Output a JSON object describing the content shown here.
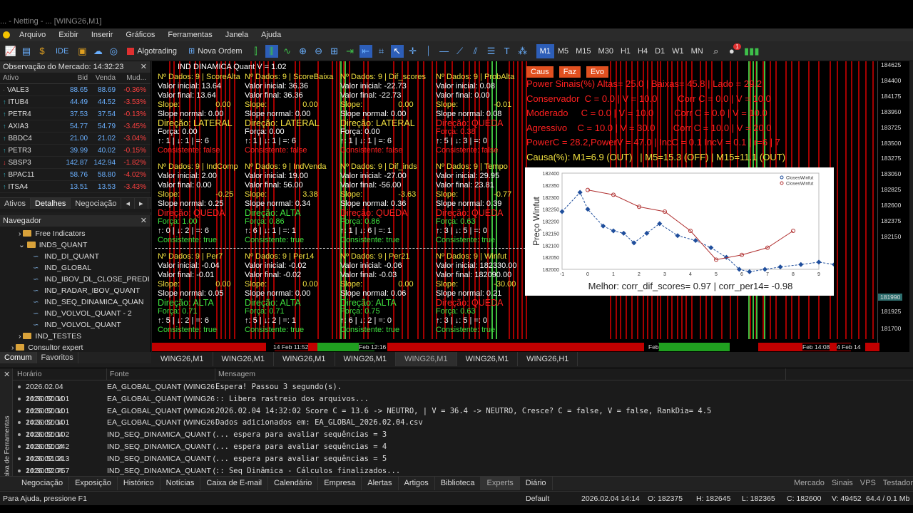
{
  "window": {
    "title_partial": "... - Netting - ... [WING26,M1]"
  },
  "menu": [
    "Arquivo",
    "Exibir",
    "Inserir",
    "Gráficos",
    "Ferramentas",
    "Janela",
    "Ajuda"
  ],
  "toolbar": {
    "algotrading": "Algotrading",
    "new_order": "Nova Ordem",
    "ide": "IDE",
    "timeframes": [
      "M1",
      "M5",
      "M15",
      "M30",
      "H1",
      "H4",
      "D1",
      "W1",
      "MN"
    ],
    "active_tf": "M1",
    "notif_count": "1"
  },
  "market_watch": {
    "title": "Observação do Mercado: 14:32:23",
    "cols": [
      "Ativo",
      "Bid",
      "Venda",
      "Mud..."
    ],
    "rows": [
      {
        "sym": "VALE3",
        "bid": "88.65",
        "ask": "88.69",
        "chg": "-0.36%",
        "dir": "none"
      },
      {
        "sym": "ITUB4",
        "bid": "44.49",
        "ask": "44.52",
        "chg": "-3.53%",
        "dir": "up"
      },
      {
        "sym": "PETR4",
        "bid": "37.53",
        "ask": "37.54",
        "chg": "-0.13%",
        "dir": "up"
      },
      {
        "sym": "AXIA3",
        "bid": "54.77",
        "ask": "54.79",
        "chg": "-3.45%",
        "dir": "up"
      },
      {
        "sym": "BBDC4",
        "bid": "21.00",
        "ask": "21.02",
        "chg": "-3.04%",
        "dir": "up"
      },
      {
        "sym": "PETR3",
        "bid": "39.99",
        "ask": "40.02",
        "chg": "-0.15%",
        "dir": "up"
      },
      {
        "sym": "SBSP3",
        "bid": "142.87",
        "ask": "142.94",
        "chg": "-1.82%",
        "dir": "down"
      },
      {
        "sym": "BPAC11",
        "bid": "58.76",
        "ask": "58.80",
        "chg": "-4.02%",
        "dir": "up"
      },
      {
        "sym": "ITSA4",
        "bid": "13.51",
        "ask": "13.53",
        "chg": "-3.43%",
        "dir": "up"
      }
    ],
    "tabs": [
      "Ativos",
      "Detalhes",
      "Negociação"
    ]
  },
  "navigator": {
    "title": "Navegador",
    "items": [
      {
        "label": "Free Indicators",
        "type": "folder",
        "indent": 2
      },
      {
        "label": "INDS_QUANT",
        "type": "folder",
        "indent": 2
      },
      {
        "label": "IND_DI_QUANT",
        "type": "ind",
        "indent": 4
      },
      {
        "label": "IND_GLOBAL",
        "type": "ind",
        "indent": 4
      },
      {
        "label": "IND_IBOV_DL_CLOSE_PREDI",
        "type": "ind",
        "indent": 4
      },
      {
        "label": "IND_RADAR_IBOV_QUANT",
        "type": "ind",
        "indent": 4
      },
      {
        "label": "IND_SEQ_DINAMICA_QUAN",
        "type": "ind",
        "indent": 4
      },
      {
        "label": "IND_VOLVOL_QUANT - 2",
        "type": "ind",
        "indent": 4
      },
      {
        "label": "IND_VOLVOL_QUANT",
        "type": "ind",
        "indent": 4
      },
      {
        "label": "IND_TESTES",
        "type": "folder",
        "indent": 2
      },
      {
        "label": "Consultor expert",
        "type": "folder",
        "indent": 1
      }
    ],
    "tabs": [
      "Comum",
      "Favoritos"
    ]
  },
  "chart": {
    "indicator_label": "IND DINAMICA Quant V = 1.02",
    "panels": [
      {
        "title": "Nº Dados: 9 | ScoreAlta",
        "vi": "Valor inicial: 13.64",
        "vf": "Valor final: 13.64",
        "slope": "Slope:",
        "slopev": "0.00",
        "sn": "Slope normal: 0.00",
        "dir": "Direção: LATERAL",
        "dircol": "y",
        "forca": "Força:  0.00",
        "fcol": "w",
        "seq": "↑: 1 | ↓: 1 | =: 6",
        "cons": "Consistente: false",
        "ccol": "r"
      },
      {
        "title": "Nº Dados: 9 | ScoreBaixa",
        "vi": "Valor inicial: 36.36",
        "vf": "Valor final: 36.36",
        "slope": "Slope:",
        "slopev": "0.00",
        "sn": "Slope normal: 0.00",
        "dir": "Direção: LATERAL",
        "dircol": "y",
        "forca": "Força:  0.00",
        "fcol": "w",
        "seq": "↑: 1 | ↓: 1 | =: 6",
        "cons": "Consistente: false",
        "ccol": "r"
      },
      {
        "title": "Nº Dados: 9 | Dif_scores",
        "vi": "Valor inicial: -22.73",
        "vf": "Valor final:  -22.73",
        "slope": "Slope:",
        "slopev": "0.00",
        "sn": "Slope normal: 0.00",
        "dir": "Direção: LATERAL",
        "dircol": "y",
        "forca": "Força:  0.00",
        "fcol": "w",
        "seq": "↑: 1 | ↓: 1 | =: 6",
        "cons": "Consistente: false",
        "ccol": "r"
      },
      {
        "title": "Nº Dados: 9 | ProbAlta",
        "vi": "Valor inicial: 0.08",
        "vf": "Valor final:  0.00",
        "slope": "Slope:",
        "slopev": "-0.01",
        "sn": "Slope normal: 0.08",
        "dir": "Direção: QUEDA",
        "dircol": "r",
        "forca": "Força:  0.38",
        "fcol": "r",
        "seq": "↑: 5 | ↓: 3 | =: 0",
        "cons": "Consistente: false",
        "ccol": "r"
      },
      {
        "title": "Nº Dados: 9 | IndComp",
        "vi": "Valor inicial: 2.00",
        "vf": "Valor final:  0.00",
        "slope": "Slope:",
        "slopev": "-0.25",
        "sn": "Slope normal: 0.25",
        "dir": "Direção: QUEDA",
        "dircol": "r",
        "forca": "Força:  1.00",
        "fcol": "g",
        "seq": "↑: 0 | ↓: 2 | =: 6",
        "cons": "Consistente: true",
        "ccol": "g"
      },
      {
        "title": "Nº Dados: 9 | IndVenda",
        "vi": "Valor inicial: 19.00",
        "vf": "Valor final:  56.00",
        "slope": "Slope:",
        "slopev": "3.38",
        "sn": "Slope normal: 0.34",
        "dir": "Direção: ALTA",
        "dircol": "g",
        "forca": "Força:  0.86",
        "fcol": "g",
        "seq": "↑: 6 | ↓: 1 | =: 1",
        "cons": "Consistente: true",
        "ccol": "g"
      },
      {
        "title": "Nº Dados: 9 | Dif_inds",
        "vi": "Valor inicial: -27.00",
        "vf": "Valor final:  -56.00",
        "slope": "Slope:",
        "slopev": "-3.63",
        "sn": "Slope normal: 0.36",
        "dir": "Direção: QUEDA",
        "dircol": "r",
        "forca": "Força:  0.86",
        "fcol": "g",
        "seq": "↑: 1 | ↓: 6 | =: 1",
        "cons": "Consistente: true",
        "ccol": "g"
      },
      {
        "title": "Nº Dados: 9 | Tempo",
        "vi": "Valor inicial: 29.95",
        "vf": "Valor final:  23.81",
        "slope": "Slope:",
        "slopev": "-0.77",
        "sn": "Slope normal: 0.39",
        "dir": "Direção: QUEDA",
        "dircol": "r",
        "forca": "Força:  0.63",
        "fcol": "g",
        "seq": "↑: 3 | ↓: 5 | =: 0",
        "cons": "Consistente: true",
        "ccol": "g"
      },
      {
        "title": "Nº Dados: 9 | Per7",
        "vi": "Valor inicial: -0.04",
        "vf": "Valor final:  -0.01",
        "slope": "Slope:",
        "slopev": "0.00",
        "sn": "Slope normal: 0.05",
        "dir": "Direção: ALTA",
        "dircol": "g",
        "forca": "Força:  0.71",
        "fcol": "g",
        "seq": "↑: 5 | ↓: 2 | =: 6",
        "cons": "Consistente: true",
        "ccol": "g"
      },
      {
        "title": "Nº Dados: 9 | Per14",
        "vi": "Valor inicial: -0.02",
        "vf": "Valor final:  -0.02",
        "slope": "Slope:",
        "slopev": "0.00",
        "sn": "Slope normal: 0.00",
        "dir": "Direção: ALTA",
        "dircol": "g",
        "forca": "Força:  0.71",
        "fcol": "g",
        "seq": "↑: 5 | ↓: 2 | =: 1",
        "cons": "Consistente: true",
        "ccol": "g"
      },
      {
        "title": "Nº Dados: 9 | Per21",
        "vi": "Valor inicial: -0.06",
        "vf": "Valor final:  -0.03",
        "slope": "Slope:",
        "slopev": "0.00",
        "sn": "Slope normal: 0.06",
        "dir": "Direção: ALTA",
        "dircol": "g",
        "forca": "Força:  0.75",
        "fcol": "g",
        "seq": "↑: 6 | ↓: 2 | =: 0",
        "cons": "Consistente: true",
        "ccol": "g"
      },
      {
        "title": "Nº Dados: 9 | Winfut",
        "vi": "Valor inicial: 182330.00",
        "vf": "Valor final:  182090.00",
        "slope": "Slope:",
        "slopev": "-30.00",
        "sn": "Slope normal: 0.21",
        "dir": "Direção: QUEDA",
        "dircol": "r",
        "forca": "Força:  0.63",
        "fcol": "g",
        "seq": "↑: 3 | ↓: 5 | =: 0",
        "cons": "Consistente: true",
        "ccol": "g"
      }
    ],
    "right_buttons": [
      "Caus",
      "Faz",
      "Evo"
    ],
    "right_lines": [
      "Power Sinais(%) Altas= 25.0 | Baixas= 45.8 | Lado = 29.2",
      "Conservador  C = 0.0 | V = 10.0        Corr C = 0.0 | V = 10.0",
      "Moderado     C = 0.0 | V = 10.0        Corr C = 0.0 | V = 10.0",
      "Agressivo    C = 10.0 | V = 30.0       Corr C = 10.0 | V = 20.0",
      "PowerC = 28.2,PowerV = 47.0 | IncC = 0.1 IncV = 0.1 | r=6 | 7",
      "Causa(%): M1=6.9 (OUT)   | M5=15.3 (OFF) | M15=11.1 (OUT)"
    ],
    "price_axis": [
      "184625",
      "184400",
      "184175",
      "183950",
      "183725",
      "183500",
      "183275",
      "183050",
      "182825",
      "182600",
      "182375",
      "182150",
      "181990",
      "181925",
      "181700"
    ],
    "current_price": "181990",
    "time_labels": [
      "14 Feb 11:52",
      "Feb 12:16",
      "Feb",
      "Feb 14:08",
      "4 Feb 14"
    ]
  },
  "inset": {
    "ylabel": "Preço Winfut",
    "legend": [
      "ClosesWinfut",
      "ClosesWinfut"
    ],
    "yticks": [
      "182400",
      "182350",
      "182300",
      "182250",
      "182200",
      "182150",
      "182100",
      "182050",
      "182000"
    ],
    "xticks": [
      "-1",
      "0",
      "1",
      "2",
      "3",
      "4",
      "5",
      "6",
      "7",
      "8",
      "9"
    ],
    "caption": "Melhor: corr_dif_scores= 0.97 | corr_per14= -0.98"
  },
  "chart_data": {
    "type": "line",
    "ylabel": "Preço Winfut",
    "ylim": [
      182000,
      182400
    ],
    "xlim": [
      -1,
      9
    ],
    "series": [
      {
        "name": "ClosesWinfut",
        "color": "#1f4e9c",
        "style": "dashed",
        "x": [
          -1,
          -0.3,
          0,
          0.6,
          1,
          1.4,
          1.8,
          2.3,
          2.8,
          3.5,
          4.2,
          4.8,
          5.4,
          5.9,
          6.3,
          6.9,
          7.5,
          8.3,
          9,
          9.6
        ],
        "y": [
          182240,
          182320,
          182250,
          182180,
          182160,
          182150,
          182110,
          182150,
          182190,
          182140,
          182120,
          182090,
          182050,
          182000,
          181990,
          182000,
          182010,
          182020,
          182030,
          182020
        ]
      },
      {
        "name": "ClosesWinfut",
        "color": "#b03030",
        "style": "solid",
        "x": [
          0,
          1,
          2,
          3,
          4,
          5,
          6,
          7,
          8
        ],
        "y": [
          182330,
          182310,
          182260,
          182240,
          182160,
          182040,
          182060,
          182090,
          182160
        ]
      }
    ],
    "caption": "Melhor: corr_dif_scores= 0.97 | corr_per14= -0.98"
  },
  "chart_tabs": [
    "WING26,M1",
    "WING26,M1",
    "WING26,M1",
    "WING26,M1",
    "WING26,M1",
    "WING26,M1",
    "WING26,H1"
  ],
  "active_chart_tab": 4,
  "toolbox": {
    "side_label": "Caixa de Ferramentas",
    "cols": [
      "Horário",
      "Fonte",
      "Mensagem"
    ],
    "rows": [
      {
        "t": "2026.02.04 14:30:50.101",
        "s": "EA_GLOBAL_QUANT (WING26,...",
        "m": "Espera! Passou 3 segundo(s)."
      },
      {
        "t": "2026.02.04 14:30:50.101",
        "s": "EA_GLOBAL_QUANT (WING26,...",
        "m": ":: Libera rastreio dos arquivos..."
      },
      {
        "t": "2026.02.04 14:30:50.101",
        "s": "EA_GLOBAL_QUANT (WING26,...",
        "m": "2026.02.04 14:32:02 Score C = 13.6 -> NEUTRO, | V = 36.4 -> NEUTRO, Cresce? C = false, V = false, RankDia= 4.5"
      },
      {
        "t": "2026.02.04 14:30:50.102",
        "s": "EA_GLOBAL_QUANT (WING26,...",
        "m": "Dados adicionados em: EA_GLOBAL_2026.02.04.csv"
      },
      {
        "t": "2026.02.04 14:30:50.242",
        "s": "IND_SEQ_DINAMICA_QUANT (...",
        "m": "... espera para avaliar sequências = 3"
      },
      {
        "t": "2026.02.04 14:30:51.213",
        "s": "IND_SEQ_DINAMICA_QUANT (...",
        "m": "... espera para avaliar sequências = 4"
      },
      {
        "t": "2026.02.04 14:30:52.757",
        "s": "IND_SEQ_DINAMICA_QUANT (...",
        "m": "... espera para avaliar sequências = 5"
      },
      {
        "t": "2026.02.04 14:30:52.786",
        "s": "IND_SEQ_DINAMICA_QUANT (...",
        "m": ":: Seq Dinâmica - Cálculos finalizados..."
      }
    ],
    "tabs": [
      "Negociação",
      "Exposição",
      "Histórico",
      "Notícias",
      "Caixa de E-mail",
      "Calendário",
      "Empresa",
      "Alertas",
      "Artigos",
      "Biblioteca",
      "Experts",
      "Diário"
    ],
    "active_tab": "Experts",
    "right": [
      "Mercado",
      "Sinais",
      "VPS",
      "Testador"
    ]
  },
  "status": {
    "help": "Para Ajuda, pressione F1",
    "profile": "Default",
    "datetime": "2026.02.04 14:14",
    "o": "O: 182375",
    "h": "H: 182645",
    "l": "L: 182365",
    "c": "C: 182600",
    "v": "V: 49452",
    "net": "64.4 / 0.1 Mb"
  },
  "colors": {
    "red": "#ff2020",
    "green": "#3ee03e",
    "yellow": "#f0e040",
    "accent": "#2d5eb8"
  }
}
